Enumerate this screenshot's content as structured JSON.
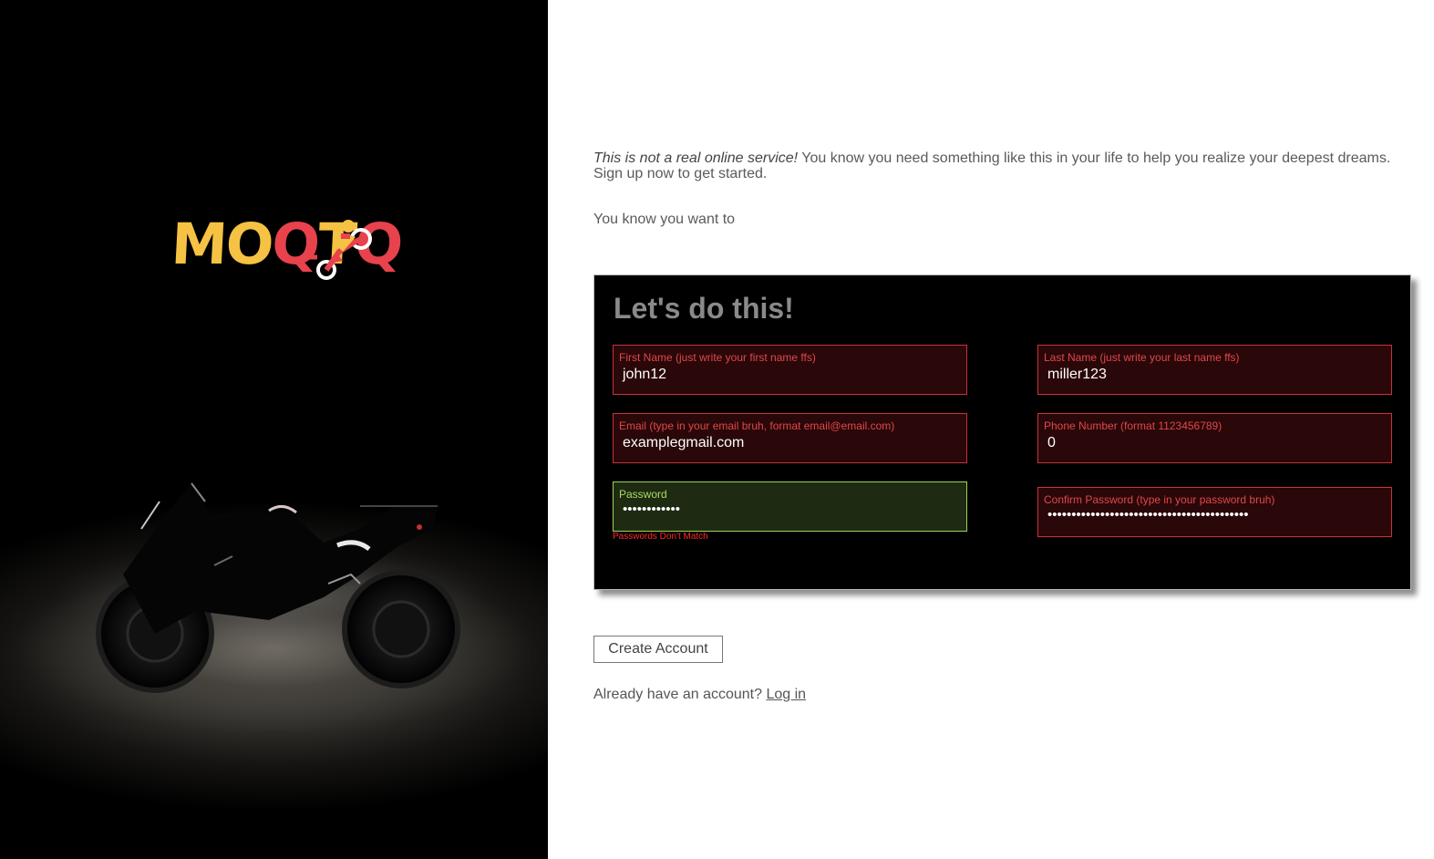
{
  "logo": {
    "text_part1": "MO",
    "text_part2": "T",
    "text_part3": "Q",
    "colors": {
      "yellow": "#f6c244",
      "red": "#e8424d"
    },
    "icon": "motorbike-rider-icon"
  },
  "intro": {
    "disclaimer": "This is not a real online service!",
    "body": " You know you need something like this in your life to help you realize your deepest dreams. Sign up now to get started.",
    "tagline": "You know you want to"
  },
  "form": {
    "title": "Let's do this!",
    "first_name": {
      "label": "First Name (just write your first name ffs)",
      "value": "john12",
      "state": "invalid"
    },
    "last_name": {
      "label": "Last Name (just write your last name ffs)",
      "value": "miller123",
      "state": "invalid"
    },
    "email": {
      "label": "Email (type in your email bruh, format email@email.com)",
      "value": "examplegmail.com",
      "state": "invalid"
    },
    "phone": {
      "label": "Phone Number (format 1123456789)",
      "value": "0",
      "state": "invalid"
    },
    "password": {
      "label": "Password",
      "value": "••••••••••••",
      "state": "valid"
    },
    "confirm_password": {
      "label": "Confirm Password (type in your password bruh)",
      "value": "••••••••••••••••••••••••••••••••••••••••••",
      "state": "invalid"
    },
    "error": "Passwords Don't Match",
    "colors": {
      "invalid_bg": "#2a0708",
      "invalid_border": "#c8333b",
      "valid_bg": "#1e2b12",
      "valid_border": "#9ad35a",
      "error_text": "#ff2a2a"
    }
  },
  "actions": {
    "create_account": "Create Account",
    "already_text": "Already have an account?",
    "login_link": "Log in"
  }
}
